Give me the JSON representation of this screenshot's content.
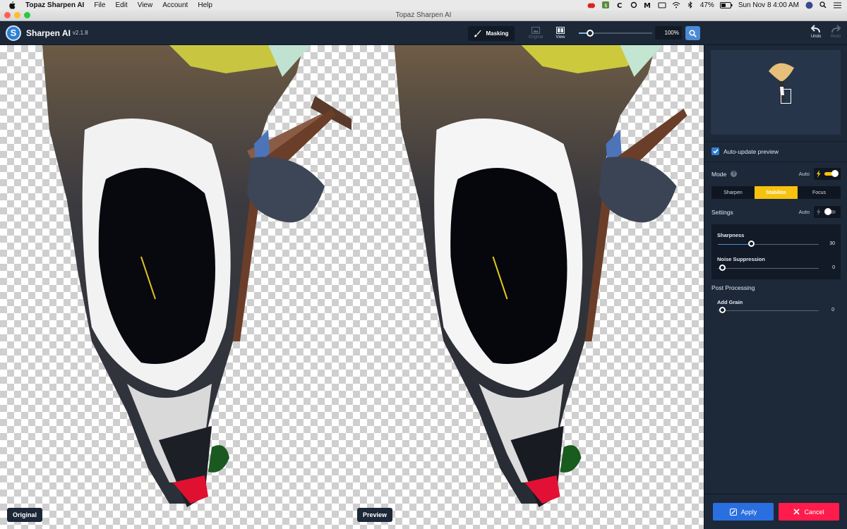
{
  "menubar": {
    "app": "Topaz Sharpen AI",
    "menus": [
      "File",
      "Edit",
      "View",
      "Account",
      "Help"
    ],
    "battery": "47%",
    "datetime": "Sun Nov 8  4:00 AM"
  },
  "window": {
    "title": "Topaz Sharpen AI"
  },
  "toolbar": {
    "app_name": "Sharpen AI",
    "version": "v2.1.8",
    "masking_label": "Masking",
    "original_label": "Original",
    "view_label": "View",
    "zoom": "100%",
    "zoom_level": 0.15,
    "undo_label": "Undo",
    "redo_label": "Redo"
  },
  "canvas": {
    "left_label": "Original",
    "right_label": "Preview"
  },
  "panel": {
    "auto_update_label": "Auto-update preview",
    "auto_update_checked": true,
    "mode_label": "Mode",
    "mode_auto_label": "Auto",
    "mode_auto_on": true,
    "modes": [
      "Sharpen",
      "Stabilize",
      "Focus"
    ],
    "active_mode": "Stabilize",
    "settings_label": "Settings",
    "settings_auto_label": "Auto",
    "settings_auto_on": false,
    "sliders": [
      {
        "label": "Sharpness",
        "value": "30",
        "fraction": 0.33
      },
      {
        "label": "Noise Suppression",
        "value": "0",
        "fraction": 0.0
      }
    ],
    "post_processing_label": "Post Processing",
    "grain": {
      "label": "Add Grain",
      "value": "0",
      "fraction": 0.0
    },
    "apply_label": "Apply",
    "cancel_label": "Cancel"
  },
  "colors": {
    "accent_blue": "#2a6fe0",
    "active_yellow": "#f6c20f",
    "cancel_red": "#ff1c4d"
  }
}
